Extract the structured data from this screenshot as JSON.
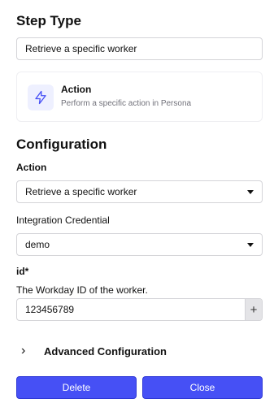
{
  "step_type": {
    "heading": "Step Type",
    "value": "Retrieve a specific worker"
  },
  "action_card": {
    "icon": "lightning-bolt-icon",
    "title": "Action",
    "description": "Perform a specific action in Persona"
  },
  "configuration": {
    "heading": "Configuration",
    "action_label": "Action",
    "action_value": "Retrieve a specific worker",
    "credential_label": "Integration Credential",
    "credential_value": "demo",
    "id_label": "id*",
    "id_description": "The Workday ID of the worker.",
    "id_value": "123456789",
    "id_add_symbol": "+"
  },
  "advanced": {
    "label": "Advanced Configuration",
    "chevron": "›"
  },
  "footer": {
    "delete_label": "Delete",
    "close_label": "Close"
  },
  "colors": {
    "primary": "#4650f5",
    "icon_bg": "#eef0ff"
  }
}
